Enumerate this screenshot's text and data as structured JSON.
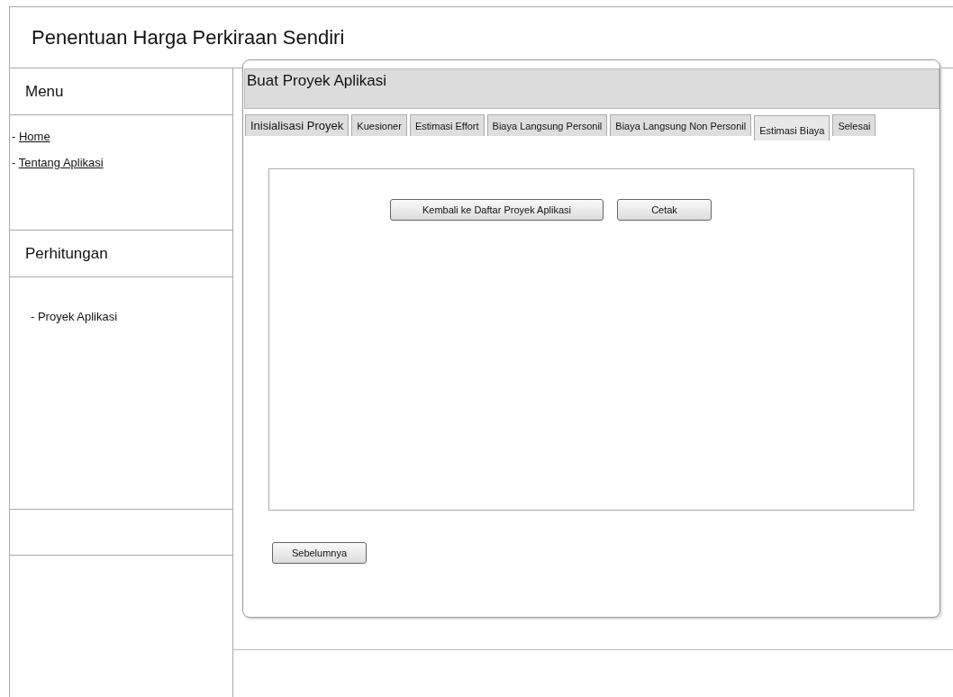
{
  "app_title": "Penentuan Harga Perkiraan Sendiri",
  "sidebar": {
    "sections": [
      {
        "title": "Menu",
        "items": [
          {
            "prefix": "- ",
            "label": "Home",
            "kind": "link"
          },
          {
            "prefix": "- ",
            "label": "Tentang Aplikasi",
            "kind": "link"
          }
        ]
      },
      {
        "title": "Perhitungan",
        "items": [
          {
            "label": "- Proyek Aplikasi",
            "kind": "text"
          }
        ]
      }
    ]
  },
  "panel": {
    "title": "Buat Proyek Aplikasi",
    "tabs": [
      {
        "label": "Inisialisasi Proyek",
        "selected": false,
        "kind": "large"
      },
      {
        "label": "Kuesioner",
        "selected": false,
        "kind": "small"
      },
      {
        "label": "Estimasi Effort",
        "selected": false,
        "kind": "small"
      },
      {
        "label": "Biaya Langsung Personil",
        "selected": false,
        "kind": "small"
      },
      {
        "label": "Biaya Langsung Non Personil",
        "selected": false,
        "kind": "small"
      },
      {
        "label": "Estimasi Biaya",
        "selected": true,
        "kind": "small"
      },
      {
        "label": "Selesai",
        "selected": false,
        "kind": "small"
      }
    ],
    "buttons": [
      "Kembali ke Daftar Proyek Aplikasi",
      "Cetak"
    ],
    "footer_button": "Sebelumnya"
  }
}
